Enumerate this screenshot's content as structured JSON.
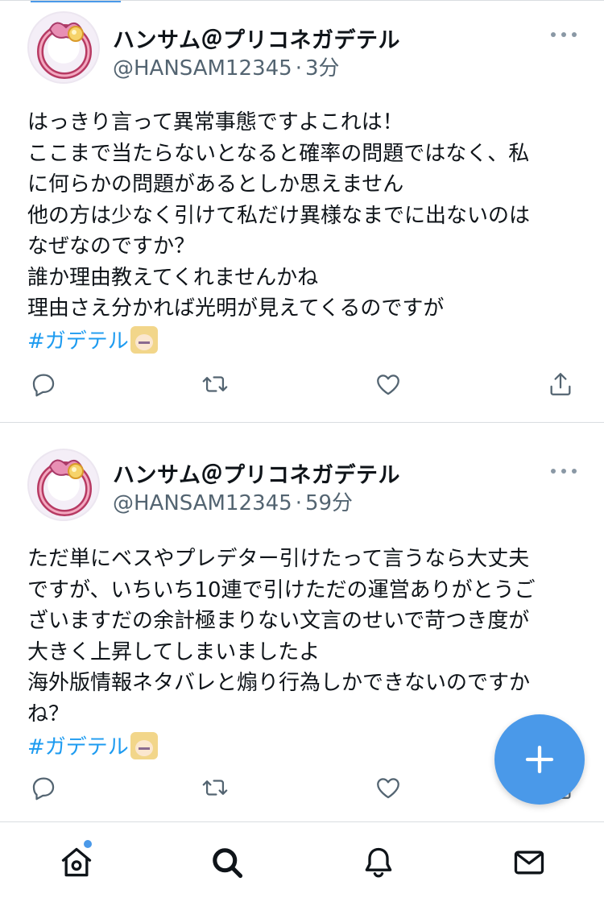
{
  "timeline": {
    "tweets": [
      {
        "display_name": "ハンサム＠プリコネガデテル",
        "handle": "@HANSAM12345",
        "separator": "·",
        "time": "3分",
        "text": "はっきり言って異常事態ですよこれは！\nここまで当たらないとなると確率の問題ではなく、私\nに何らかの問題があるとしか思えません\n他の方は少なく引けて私だけ異様なまでに出ないのは\nなぜなのですか？\n誰か理由教えてくれませんかね\n理由さえ分かれば光明が見えてくるのですが",
        "hashtag": "#ガデテル",
        "avatar_icon": "pink-ring-avatar-icon",
        "hashtag_emoji_icon": "anime-character-face-icon"
      },
      {
        "display_name": "ハンサム＠プリコネガデテル",
        "handle": "@HANSAM12345",
        "separator": "·",
        "time": "59分",
        "text": "ただ単にベスやプレデター引けたって言うなら大丈夫\nですが、いちいち10連で引けただの運営ありがとうご\nざいますだの余計極まりない文言のせいで苛つき度が\n大きく上昇してしまいましたよ\n海外版情報ネタバレと煽り行為しかできないのですか\nね？",
        "hashtag": "#ガデテル",
        "avatar_icon": "pink-ring-avatar-icon",
        "hashtag_emoji_icon": "anime-character-face-icon"
      }
    ]
  },
  "icons": {
    "more": "more-dots-icon",
    "reply": "reply-icon",
    "retweet": "retweet-icon",
    "like": "heart-icon",
    "share": "share-icon",
    "compose": "plus-icon",
    "home": "home-icon",
    "search": "search-icon",
    "notifications": "bell-icon",
    "messages": "envelope-icon"
  },
  "colors": {
    "accent": "#4a99e9",
    "hashtag": "#1d9bf0",
    "secondary_text": "#536471",
    "icon_gray": "#536471"
  }
}
